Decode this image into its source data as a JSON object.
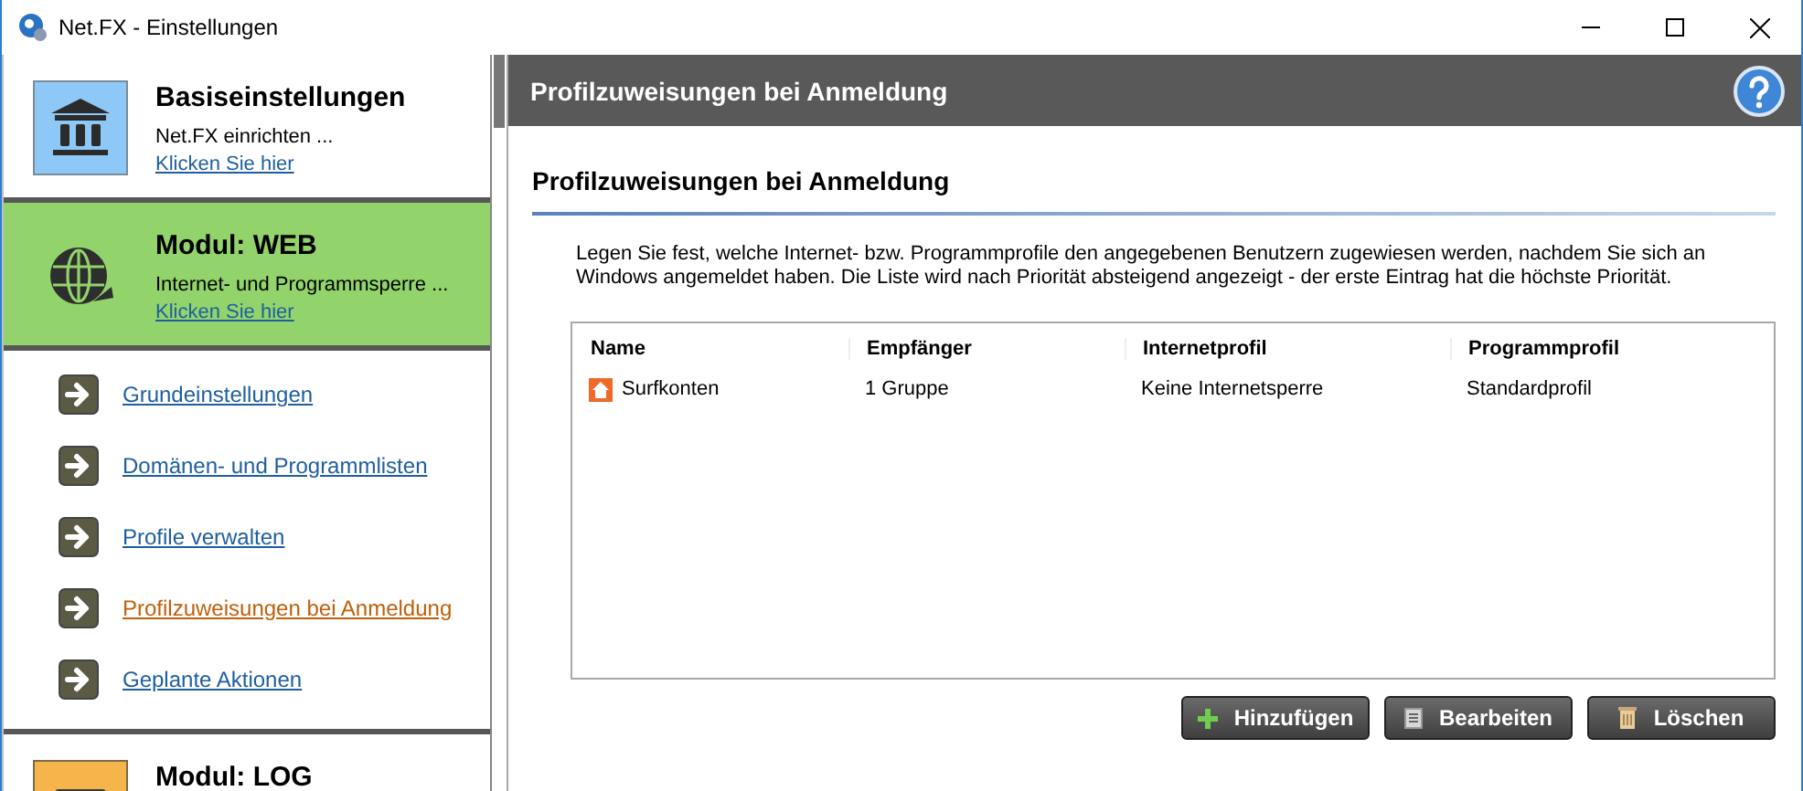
{
  "window": {
    "title": "Net.FX - Einstellungen"
  },
  "sidebar": {
    "modules": [
      {
        "kind": "basis",
        "title": "Basiseinstellungen",
        "subtitle": "Net.FX einrichten ...",
        "link": "Klicken Sie hier",
        "selected": false
      },
      {
        "kind": "web",
        "title": "Modul: WEB",
        "subtitle": "Internet- und Programmsperre ...",
        "link": "Klicken Sie hier",
        "selected": true
      },
      {
        "kind": "log",
        "title": "Modul: LOG",
        "selected": false
      }
    ],
    "nav_items": [
      {
        "label": "Grundeinstellungen",
        "selected": false
      },
      {
        "label": "Domänen- und Programmlisten",
        "selected": false
      },
      {
        "label": "Profile verwalten",
        "selected": false
      },
      {
        "label": "Profilzuweisungen bei Anmeldung",
        "selected": true
      },
      {
        "label": "Geplante Aktionen",
        "selected": false
      }
    ]
  },
  "header": {
    "title": "Profilzuweisungen bei Anmeldung"
  },
  "section": {
    "title": "Profilzuweisungen bei Anmeldung",
    "description": "Legen Sie fest, welche Internet- bzw. Programmprofile den angegebenen Benutzern zugewiesen werden, nachdem Sie sich an Windows angemeldet haben. Die Liste wird nach Priorität absteigend angezeigt - der erste Eintrag hat die höchste Priorität."
  },
  "table": {
    "columns": [
      "Name",
      "Empfänger",
      "Internetprofil",
      "Programmprofil"
    ],
    "rows": [
      {
        "cells": [
          "Surfkonten",
          "1 Gruppe",
          "Keine Internetsperre",
          "Standardprofil"
        ]
      }
    ]
  },
  "buttons": [
    {
      "kind": "add",
      "label": "Hinzufügen"
    },
    {
      "kind": "edit",
      "label": "Bearbeiten"
    },
    {
      "kind": "delete",
      "label": "Löschen"
    }
  ]
}
